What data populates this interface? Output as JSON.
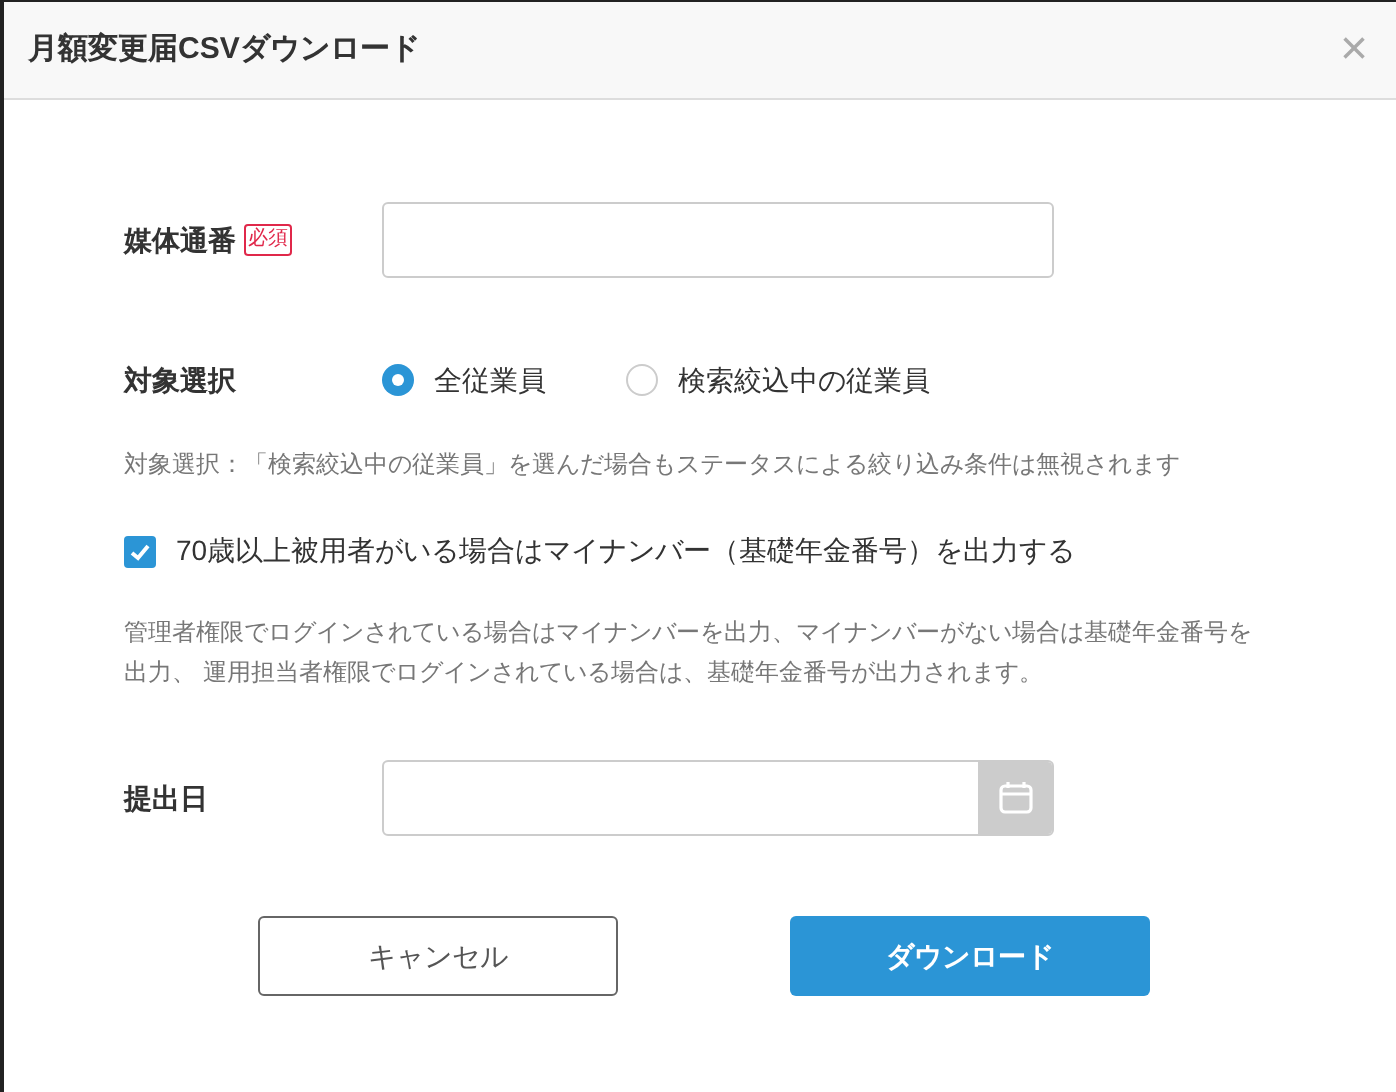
{
  "dialog": {
    "title": "月額変更届CSVダウンロード",
    "close": "×"
  },
  "media_number": {
    "label": "媒体通番",
    "required_badge": "必須"
  },
  "target": {
    "label": "対象選択",
    "options": [
      {
        "label": "全従業員",
        "selected": true
      },
      {
        "label": "検索絞込中の従業員",
        "selected": false
      }
    ],
    "note": "対象選択：「検索絞込中の従業員」を選んだ場合もステータスによる絞り込み条件は無視されます"
  },
  "mynumber_option": {
    "label": "70歳以上被用者がいる場合はマイナンバー（基礎年金番号）を出力する",
    "checked": true,
    "note": "管理者権限でログインされている場合はマイナンバーを出力、マイナンバーがない場合は基礎年金番号を出力、 運用担当者権限でログインされている場合は、基礎年金番号が出力されます。"
  },
  "submission_date": {
    "label": "提出日"
  },
  "buttons": [
    {
      "label": "キャンセル",
      "kind": "secondary"
    },
    {
      "label": "ダウンロード",
      "kind": "primary"
    }
  ]
}
